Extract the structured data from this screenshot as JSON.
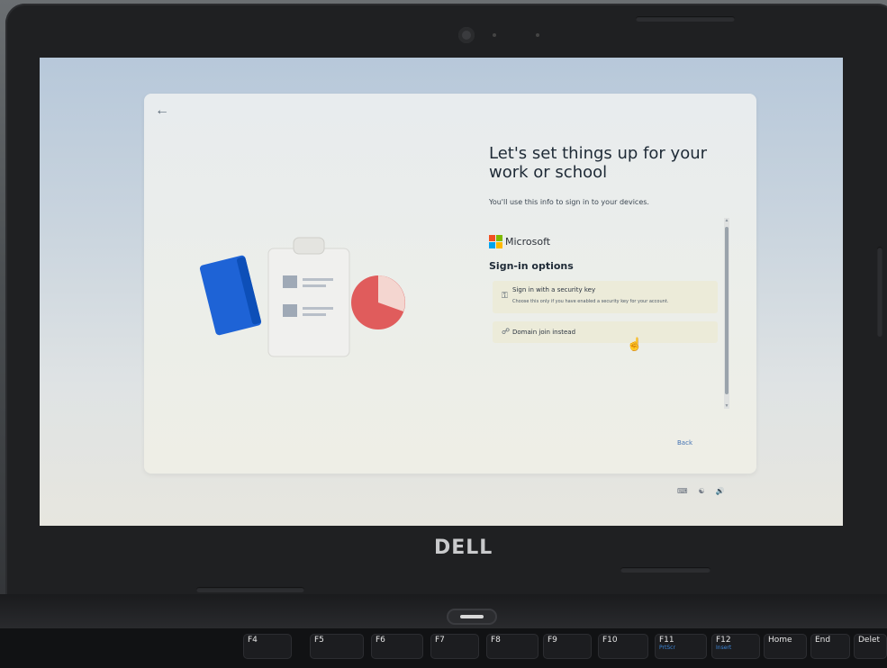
{
  "laptop": {
    "brand": "DELL"
  },
  "oobe": {
    "title": "Let's set things up for your work or school",
    "subtitle": "You'll use this info to sign in to your devices.",
    "provider": "Microsoft",
    "signin_heading": "Sign-in options",
    "options": [
      {
        "label": "Sign in with a security key",
        "description": "Choose this only if you have enabled a security key for your account.",
        "icon": "key-icon"
      },
      {
        "label": "Domain join instead",
        "icon": "domain-icon"
      }
    ],
    "back_label": "Back",
    "microsoft_logo_colors": [
      "#f25022",
      "#7fba00",
      "#00a4ef",
      "#ffb900"
    ]
  },
  "keyboard": {
    "keys": [
      {
        "label": "F4"
      },
      {
        "label": "F5"
      },
      {
        "label": "F6"
      },
      {
        "label": "F7"
      },
      {
        "label": "F8"
      },
      {
        "label": "F9"
      },
      {
        "label": "F10"
      },
      {
        "label": "F11",
        "sub": "PrtScr"
      },
      {
        "label": "F12",
        "sub": "Insert"
      },
      {
        "label": "Home"
      },
      {
        "label": "End"
      },
      {
        "label": "Delet"
      }
    ]
  }
}
